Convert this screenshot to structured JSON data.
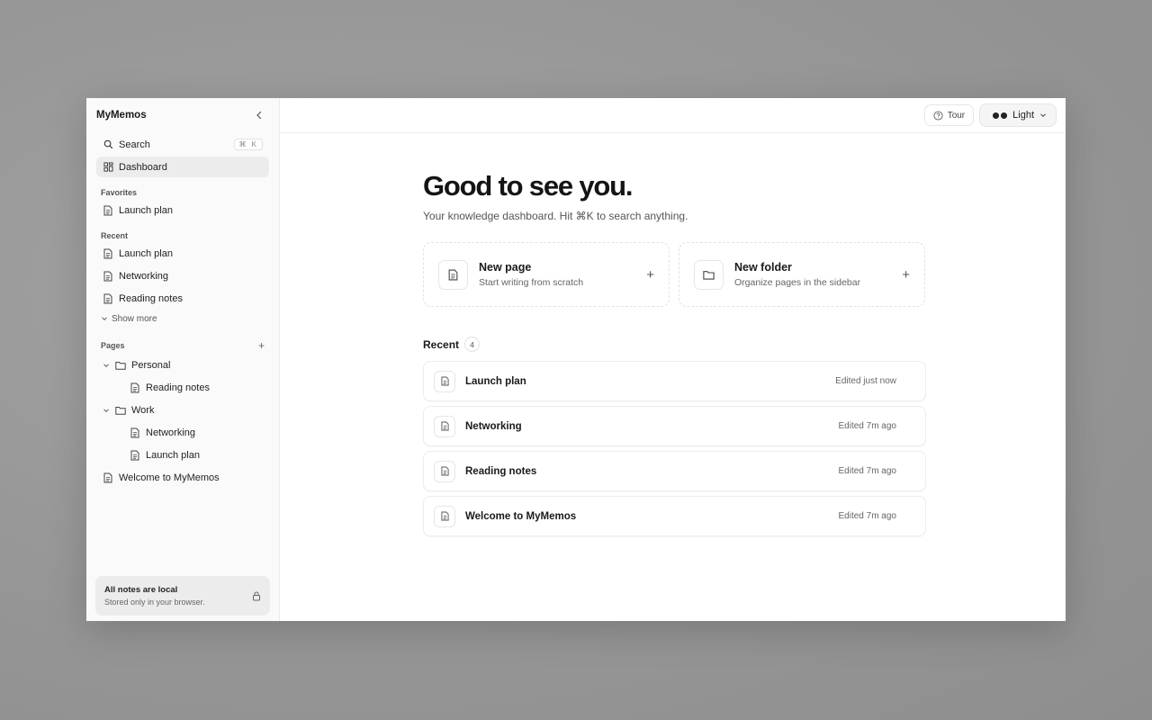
{
  "app": {
    "title": "MyMemos"
  },
  "sidebar": {
    "search_label": "Search",
    "search_shortcut": "⌘ K",
    "dashboard_label": "Dashboard",
    "favorites_label": "Favorites",
    "favorites": [
      {
        "label": "Launch plan"
      }
    ],
    "recent_label": "Recent",
    "recent": [
      {
        "label": "Launch plan"
      },
      {
        "label": "Networking"
      },
      {
        "label": "Reading notes"
      }
    ],
    "show_more_label": "Show more",
    "pages_label": "Pages",
    "pages": {
      "folders": [
        {
          "label": "Personal",
          "children": [
            {
              "label": "Reading notes"
            }
          ]
        },
        {
          "label": "Work",
          "children": [
            {
              "label": "Networking"
            },
            {
              "label": "Launch plan"
            }
          ]
        }
      ],
      "root_pages": [
        {
          "label": "Welcome to MyMemos"
        }
      ]
    },
    "footer": {
      "title": "All notes are local",
      "subtitle": "Stored only in your browser."
    }
  },
  "topbar": {
    "tour_label": "Tour",
    "theme_label": "Light"
  },
  "main": {
    "greeting": "Good to see you.",
    "subtitle": "Your knowledge dashboard. Hit ⌘K to search anything.",
    "actions": [
      {
        "title": "New page",
        "desc": "Start writing from scratch",
        "icon": "file-icon"
      },
      {
        "title": "New folder",
        "desc": "Organize pages in the sidebar",
        "icon": "folder-icon"
      }
    ],
    "recent_title": "Recent",
    "recent_count": "4",
    "recent_items": [
      {
        "title": "Launch plan",
        "time": "Edited just now"
      },
      {
        "title": "Networking",
        "time": "Edited 7m ago"
      },
      {
        "title": "Reading notes",
        "time": "Edited 7m ago"
      },
      {
        "title": "Welcome to MyMemos",
        "time": "Edited 7m ago"
      }
    ]
  },
  "colors": {
    "backdrop": "#9a9a9a",
    "sidebar_bg": "#fafafa",
    "active_item": "#ececec",
    "text": "#1a1a1a",
    "muted": "#666666"
  }
}
